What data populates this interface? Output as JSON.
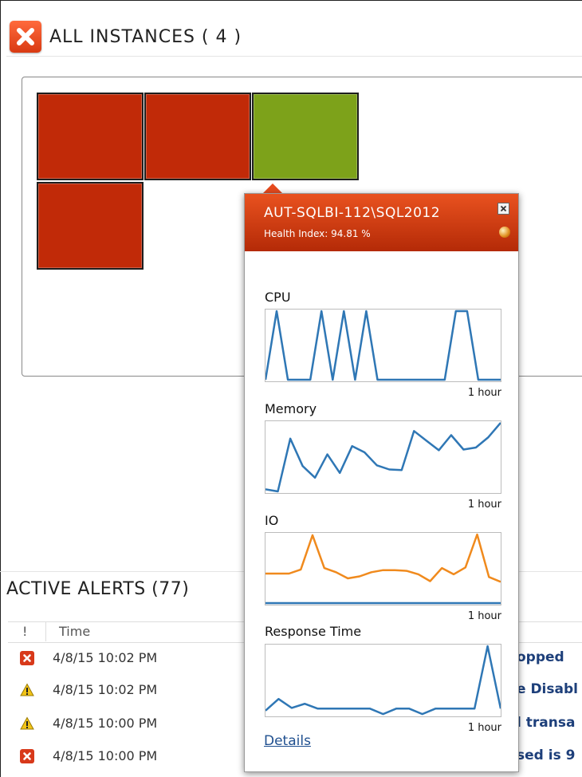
{
  "header": {
    "title": "ALL INSTANCES ( 4 )",
    "status_icon": "error-x-icon",
    "status_color": "#d93a12"
  },
  "instances": [
    {
      "status": "critical",
      "color": "#c12a08"
    },
    {
      "status": "critical",
      "color": "#c12a08"
    },
    {
      "status": "ok",
      "color": "#7da21a"
    },
    {
      "status": "critical",
      "color": "#c12a08"
    }
  ],
  "popup": {
    "title": "AUT-SQLBI-112\\SQL2012",
    "health_index": "Health Index: 94.81 %",
    "close_icon": "close-icon",
    "globe_icon": "globe-icon",
    "details_label": "Details",
    "metrics": [
      {
        "label": "CPU",
        "span": "1 hour",
        "color": "#2f77b5",
        "series": [
          0,
          100,
          0,
          0,
          0,
          100,
          0,
          100,
          0,
          100,
          0,
          0,
          0,
          0,
          0,
          0,
          0,
          100,
          100,
          0,
          0,
          0
        ]
      },
      {
        "label": "Memory",
        "span": "1 hour",
        "color": "#2f77b5",
        "series": [
          3,
          0,
          77,
          37,
          20,
          54,
          27,
          66,
          57,
          38,
          32,
          31,
          88,
          74,
          60,
          82,
          61,
          64,
          79,
          100
        ]
      },
      {
        "label": "IO",
        "span": "1 hour",
        "color": "#f08a1d",
        "baseline_color": "#2f77b5",
        "series": [
          43,
          43,
          43,
          49,
          99,
          51,
          45,
          36,
          39,
          45,
          48,
          48,
          47,
          42,
          32,
          51,
          42,
          52,
          100,
          38,
          31
        ]
      },
      {
        "label": "Response Time",
        "span": "1 hour",
        "color": "#2f77b5",
        "series": [
          6,
          23,
          10,
          16,
          9,
          9,
          9,
          9,
          9,
          1,
          9,
          9,
          1,
          9,
          9,
          9,
          9,
          100,
          9
        ]
      }
    ]
  },
  "alerts": {
    "title": "ACTIVE ALERTS (77)",
    "columns": [
      "!",
      "Time"
    ],
    "rows": [
      {
        "severity": "critical",
        "icon": "error-x-icon",
        "time": "4/8/15 10:02 PM",
        "message": "opped"
      },
      {
        "severity": "warning",
        "icon": "warning-triangle-icon",
        "time": "4/8/15 10:02 PM",
        "message": "e Disabl"
      },
      {
        "severity": "warning",
        "icon": "warning-triangle-icon",
        "time": "4/8/15 10:00 PM",
        "message": "l transa"
      },
      {
        "severity": "critical",
        "icon": "error-x-icon",
        "time": "4/8/15 10:00 PM",
        "message": "sed is 9"
      }
    ]
  }
}
